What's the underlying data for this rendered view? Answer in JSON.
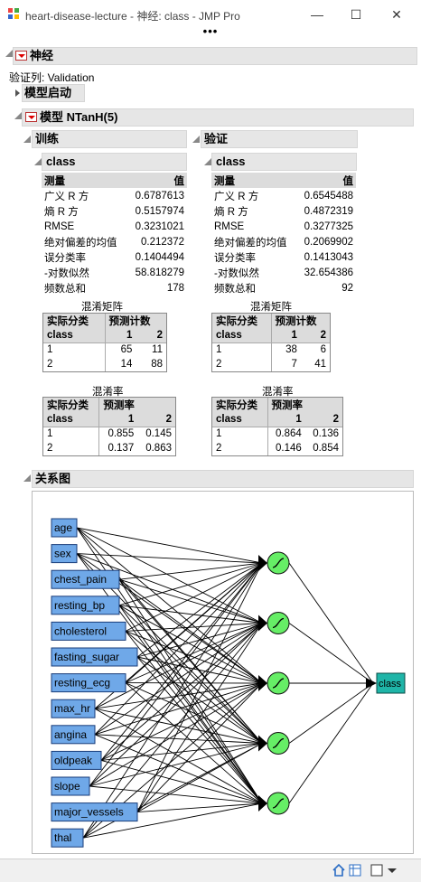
{
  "window": {
    "title": "heart-disease-lecture - 神经: class - JMP Pro",
    "minimize": "—",
    "maximize": "☐",
    "close": "✕"
  },
  "report": {
    "title": "神经",
    "validation_label": "验证列: Validation",
    "model_launch": "模型启动",
    "model_title": "模型 NTanH(5)",
    "diagram_title": "关系图"
  },
  "training": {
    "title": "训练",
    "class_title": "class",
    "header_measure": "测量",
    "header_value": "值",
    "stats": [
      {
        "label": "广义 R 方",
        "value": "0.6787613"
      },
      {
        "label": "熵 R 方",
        "value": "0.5157974"
      },
      {
        "label": "RMSE",
        "value": "0.3231021"
      },
      {
        "label": "绝对偏差的均值",
        "value": "0.212372"
      },
      {
        "label": "误分类率",
        "value": "0.1404494"
      },
      {
        "label": "-对数似然",
        "value": "58.818279"
      },
      {
        "label": "频数总和",
        "value": "178"
      }
    ],
    "confusion": {
      "title": "混淆矩阵",
      "h1": "实际分类",
      "h2": "预测计数",
      "class_label": "class",
      "col1": "1",
      "col2": "2",
      "rows": [
        {
          "label": "1",
          "a": "65",
          "b": "11"
        },
        {
          "label": "2",
          "a": "14",
          "b": "88"
        }
      ]
    },
    "rates": {
      "title": "混淆率",
      "h1": "实际分类",
      "h2": "预测率",
      "class_label": "class",
      "col1": "1",
      "col2": "2",
      "rows": [
        {
          "label": "1",
          "a": "0.855",
          "b": "0.145"
        },
        {
          "label": "2",
          "a": "0.137",
          "b": "0.863"
        }
      ]
    }
  },
  "validation": {
    "title": "验证",
    "class_title": "class",
    "header_measure": "测量",
    "header_value": "值",
    "stats": [
      {
        "label": "广义 R 方",
        "value": "0.6545488"
      },
      {
        "label": "熵 R 方",
        "value": "0.4872319"
      },
      {
        "label": "RMSE",
        "value": "0.3277325"
      },
      {
        "label": "绝对偏差的均值",
        "value": "0.2069902"
      },
      {
        "label": "误分类率",
        "value": "0.1413043"
      },
      {
        "label": "-对数似然",
        "value": "32.654386"
      },
      {
        "label": "频数总和",
        "value": "92"
      }
    ],
    "confusion": {
      "title": "混淆矩阵",
      "h1": "实际分类",
      "h2": "预测计数",
      "class_label": "class",
      "col1": "1",
      "col2": "2",
      "rows": [
        {
          "label": "1",
          "a": "38",
          "b": "6"
        },
        {
          "label": "2",
          "a": "7",
          "b": "41"
        }
      ]
    },
    "rates": {
      "title": "混淆率",
      "h1": "实际分类",
      "h2": "预测率",
      "class_label": "class",
      "col1": "1",
      "col2": "2",
      "rows": [
        {
          "label": "1",
          "a": "0.864",
          "b": "0.136"
        },
        {
          "label": "2",
          "a": "0.146",
          "b": "0.854"
        }
      ]
    }
  },
  "diagram": {
    "inputs": [
      "age",
      "sex",
      "chest_pain",
      "resting_bp",
      "cholesterol",
      "fasting_sugar",
      "resting_ecg",
      "max_hr",
      "angina",
      "oldpeak",
      "slope",
      "major_vessels",
      "thal"
    ],
    "hidden_nodes": 5,
    "output": "class",
    "input_fill": "#6fa8e8",
    "hidden_fill": "#66ee66",
    "output_fill": "#1fb5a8"
  },
  "statusbar": {
    "icons": [
      "home-icon",
      "table-icon",
      "window-icon",
      "dropdown-icon"
    ]
  }
}
